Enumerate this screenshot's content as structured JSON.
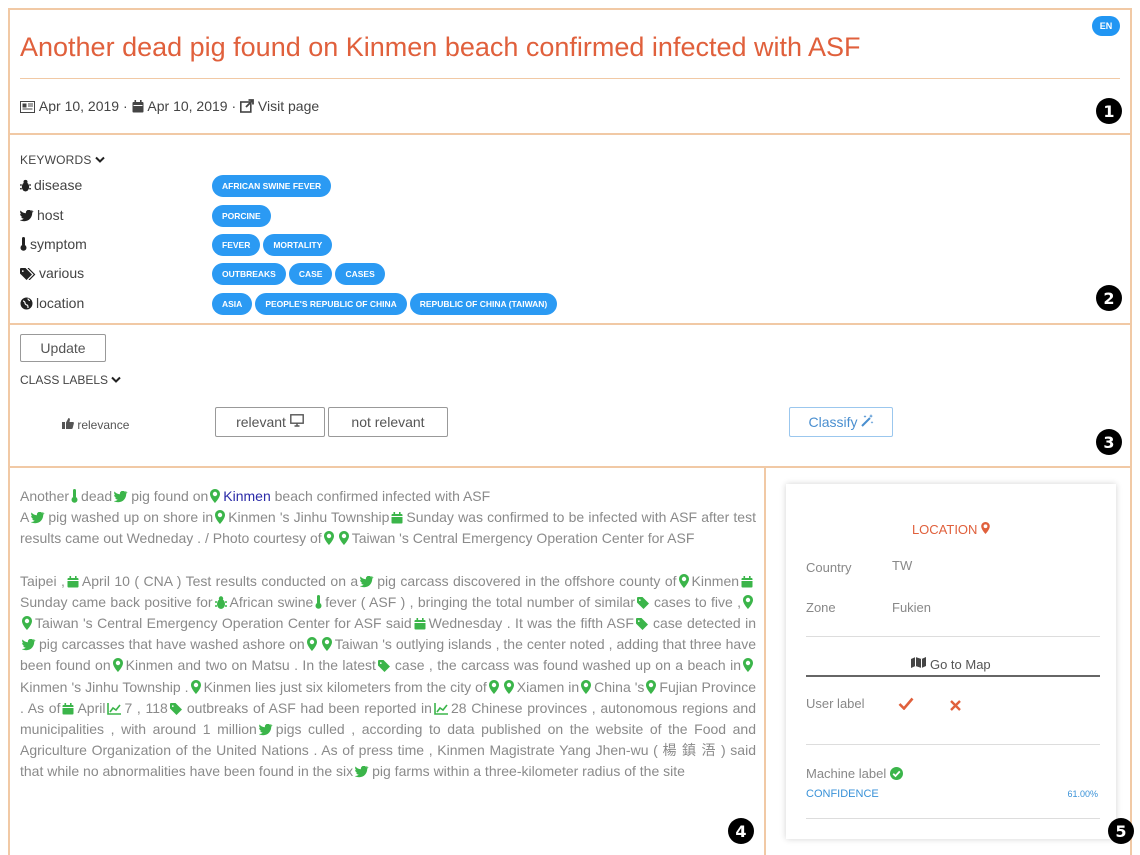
{
  "header": {
    "title": "Another dead pig found on Kinmen beach confirmed infected with ASF",
    "language_badge": "EN",
    "published_date": "Apr 10, 2019",
    "separator": "·",
    "event_date": "Apr 10, 2019",
    "visit_page_label": "Visit page"
  },
  "section_numbers": [
    "1",
    "2",
    "3",
    "4",
    "5"
  ],
  "keywords": {
    "heading": "KEYWORDS",
    "rows": [
      {
        "label": "disease",
        "icon": "bug-icon",
        "tags": [
          "AFRICAN SWINE FEVER"
        ]
      },
      {
        "label": "host",
        "icon": "bird-icon",
        "tags": [
          "PORCINE"
        ]
      },
      {
        "label": "symptom",
        "icon": "thermometer-icon",
        "tags": [
          "FEVER",
          "MORTALITY"
        ]
      },
      {
        "label": "various",
        "icon": "tags-icon",
        "tags": [
          "OUTBREAKS",
          "CASE",
          "CASES"
        ]
      },
      {
        "label": "location",
        "icon": "globe-icon",
        "tags": [
          "ASIA",
          "PEOPLE'S REPUBLIC OF CHINA",
          "REPUBLIC OF CHINA (TAIWAN)"
        ]
      }
    ]
  },
  "class_labels": {
    "update_label": "Update",
    "heading": "CLASS LABELS",
    "relevance_label": "relevance",
    "relevant_label": "relevant",
    "not_relevant_label": "not relevant",
    "classify_label": "Classify"
  },
  "article": {
    "p0": {
      "t0": "Another",
      "t1": "dead",
      "t2": "pig found on",
      "t3": "Kinmen",
      "t4": "beach confirmed infected with ASF"
    },
    "p1": {
      "t0": "A",
      "t1": "pig washed up on shore in",
      "t2": "Kinmen 's Jinhu Township",
      "t3": "Sunday was confirmed to be infected with ASF after test results came out Wedneday . / Photo courtesy of",
      "t4": "Taiwan 's Central Emergency Operation Center for ASF"
    },
    "p2": {
      "t0": "Taipei ,",
      "t1": "April 10 ( CNA ) Test results conducted on a",
      "t2": "pig carcass discovered in the offshore county of",
      "t3": "Kinmen",
      "t4": "Sunday came back positive for",
      "t5": "African swine",
      "t6": "fever ( ASF ) , bringing the total number of similar",
      "t7": "cases to five ,",
      "t8": "Taiwan 's Central Emergency Operation Center for ASF said",
      "t9": "Wednesday . It was the fifth ASF",
      "t10": "case detected in",
      "t11": "pig carcasses that have washed ashore on",
      "t12": "Taiwan 's outlying islands , the center noted , adding that three have been found on",
      "t13": "Kinmen and two on Matsu . In the latest",
      "t14": "case , the carcass was found washed up on a beach in",
      "t15": "Kinmen 's Jinhu Township .",
      "t16": "Kinmen lies just six kilometers from the city of",
      "t17": "Xiamen in",
      "t18": "China 's",
      "t19": "Fujian Province . As of",
      "t20": "April",
      "t21": "7 , 118",
      "t22": "outbreaks of ASF had been reported in",
      "t23": "28 Chinese provinces , autonomous regions and municipalities , with around 1 million",
      "t24": "pigs culled , according to data published on the website of the Food and Agriculture Organization of the United Nations . As of press time , Kinmen Magistrate Yang Jhen-wu ( 楊 鎮 浯 ) said that while no abnormalities have been found in the six",
      "t25": "pig farms within a three-kilometer radius of the site"
    }
  },
  "location_card": {
    "heading": "LOCATION",
    "country_label": "Country",
    "country_value": "TW",
    "zone_label": "Zone",
    "zone_value": "Fukien",
    "go_to_map_label": "Go to Map",
    "user_label": "User label",
    "machine_label": "Machine label",
    "confidence_label": "CONFIDENCE",
    "confidence_value": "61.00%"
  },
  "colors": {
    "title": "#e0603c",
    "panel_border": "#f1c9a5",
    "tag": "#2b9af3",
    "annotation_icon": "#3bb54a",
    "link": "#2a2aa8",
    "confidence": "#3a92d8",
    "check": "#e0603c",
    "cross": "#e0603c"
  }
}
